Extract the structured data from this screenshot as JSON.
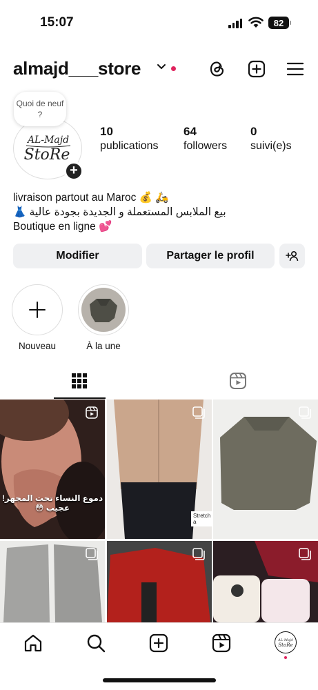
{
  "status": {
    "time": "15:07",
    "battery": "82"
  },
  "header": {
    "username": "almajd___store"
  },
  "profile": {
    "note_bubble": "Quoi de neuf ?",
    "avatar_text_line1": "AL-Majd",
    "avatar_text_line2": "StoRe",
    "stats": [
      {
        "value": "10",
        "label": "publications"
      },
      {
        "value": "64",
        "label": "followers"
      },
      {
        "value": "0",
        "label": "suivi(e)s"
      }
    ],
    "bio": [
      "livraison partout au Maroc 💰 🛵",
      "بيع الملابس المستعملة و الجديدة بجودة عالية 👗",
      "Boutique en ligne 💕"
    ]
  },
  "buttons": {
    "edit": "Modifier",
    "share": "Partager le profil"
  },
  "highlights": [
    {
      "label": "Nouveau"
    },
    {
      "label": "À la une"
    }
  ],
  "grid": {
    "post1_overlay": "دموع النساء تحت المجهر! عجيب 😳",
    "post2_tag": "Stretch a"
  },
  "colors": {
    "accent_red": "#e0245e",
    "button_bg": "#eff0f2"
  },
  "icons": [
    "threads-icon",
    "create-icon",
    "menu-icon",
    "grid-icon",
    "reels-tab-icon",
    "home-icon",
    "search-icon",
    "new-post-icon",
    "reels-icon",
    "profile-icon"
  ]
}
